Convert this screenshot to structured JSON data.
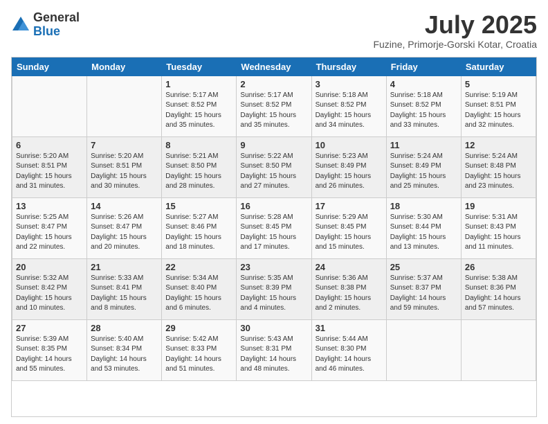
{
  "logo": {
    "general": "General",
    "blue": "Blue"
  },
  "title": "July 2025",
  "location": "Fuzine, Primorje-Gorski Kotar, Croatia",
  "weekdays": [
    "Sunday",
    "Monday",
    "Tuesday",
    "Wednesday",
    "Thursday",
    "Friday",
    "Saturday"
  ],
  "weeks": [
    [
      {
        "day": "",
        "detail": ""
      },
      {
        "day": "",
        "detail": ""
      },
      {
        "day": "1",
        "detail": "Sunrise: 5:17 AM\nSunset: 8:52 PM\nDaylight: 15 hours and 35 minutes."
      },
      {
        "day": "2",
        "detail": "Sunrise: 5:17 AM\nSunset: 8:52 PM\nDaylight: 15 hours and 35 minutes."
      },
      {
        "day": "3",
        "detail": "Sunrise: 5:18 AM\nSunset: 8:52 PM\nDaylight: 15 hours and 34 minutes."
      },
      {
        "day": "4",
        "detail": "Sunrise: 5:18 AM\nSunset: 8:52 PM\nDaylight: 15 hours and 33 minutes."
      },
      {
        "day": "5",
        "detail": "Sunrise: 5:19 AM\nSunset: 8:51 PM\nDaylight: 15 hours and 32 minutes."
      }
    ],
    [
      {
        "day": "6",
        "detail": "Sunrise: 5:20 AM\nSunset: 8:51 PM\nDaylight: 15 hours and 31 minutes."
      },
      {
        "day": "7",
        "detail": "Sunrise: 5:20 AM\nSunset: 8:51 PM\nDaylight: 15 hours and 30 minutes."
      },
      {
        "day": "8",
        "detail": "Sunrise: 5:21 AM\nSunset: 8:50 PM\nDaylight: 15 hours and 28 minutes."
      },
      {
        "day": "9",
        "detail": "Sunrise: 5:22 AM\nSunset: 8:50 PM\nDaylight: 15 hours and 27 minutes."
      },
      {
        "day": "10",
        "detail": "Sunrise: 5:23 AM\nSunset: 8:49 PM\nDaylight: 15 hours and 26 minutes."
      },
      {
        "day": "11",
        "detail": "Sunrise: 5:24 AM\nSunset: 8:49 PM\nDaylight: 15 hours and 25 minutes."
      },
      {
        "day": "12",
        "detail": "Sunrise: 5:24 AM\nSunset: 8:48 PM\nDaylight: 15 hours and 23 minutes."
      }
    ],
    [
      {
        "day": "13",
        "detail": "Sunrise: 5:25 AM\nSunset: 8:47 PM\nDaylight: 15 hours and 22 minutes."
      },
      {
        "day": "14",
        "detail": "Sunrise: 5:26 AM\nSunset: 8:47 PM\nDaylight: 15 hours and 20 minutes."
      },
      {
        "day": "15",
        "detail": "Sunrise: 5:27 AM\nSunset: 8:46 PM\nDaylight: 15 hours and 18 minutes."
      },
      {
        "day": "16",
        "detail": "Sunrise: 5:28 AM\nSunset: 8:45 PM\nDaylight: 15 hours and 17 minutes."
      },
      {
        "day": "17",
        "detail": "Sunrise: 5:29 AM\nSunset: 8:45 PM\nDaylight: 15 hours and 15 minutes."
      },
      {
        "day": "18",
        "detail": "Sunrise: 5:30 AM\nSunset: 8:44 PM\nDaylight: 15 hours and 13 minutes."
      },
      {
        "day": "19",
        "detail": "Sunrise: 5:31 AM\nSunset: 8:43 PM\nDaylight: 15 hours and 11 minutes."
      }
    ],
    [
      {
        "day": "20",
        "detail": "Sunrise: 5:32 AM\nSunset: 8:42 PM\nDaylight: 15 hours and 10 minutes."
      },
      {
        "day": "21",
        "detail": "Sunrise: 5:33 AM\nSunset: 8:41 PM\nDaylight: 15 hours and 8 minutes."
      },
      {
        "day": "22",
        "detail": "Sunrise: 5:34 AM\nSunset: 8:40 PM\nDaylight: 15 hours and 6 minutes."
      },
      {
        "day": "23",
        "detail": "Sunrise: 5:35 AM\nSunset: 8:39 PM\nDaylight: 15 hours and 4 minutes."
      },
      {
        "day": "24",
        "detail": "Sunrise: 5:36 AM\nSunset: 8:38 PM\nDaylight: 15 hours and 2 minutes."
      },
      {
        "day": "25",
        "detail": "Sunrise: 5:37 AM\nSunset: 8:37 PM\nDaylight: 14 hours and 59 minutes."
      },
      {
        "day": "26",
        "detail": "Sunrise: 5:38 AM\nSunset: 8:36 PM\nDaylight: 14 hours and 57 minutes."
      }
    ],
    [
      {
        "day": "27",
        "detail": "Sunrise: 5:39 AM\nSunset: 8:35 PM\nDaylight: 14 hours and 55 minutes."
      },
      {
        "day": "28",
        "detail": "Sunrise: 5:40 AM\nSunset: 8:34 PM\nDaylight: 14 hours and 53 minutes."
      },
      {
        "day": "29",
        "detail": "Sunrise: 5:42 AM\nSunset: 8:33 PM\nDaylight: 14 hours and 51 minutes."
      },
      {
        "day": "30",
        "detail": "Sunrise: 5:43 AM\nSunset: 8:31 PM\nDaylight: 14 hours and 48 minutes."
      },
      {
        "day": "31",
        "detail": "Sunrise: 5:44 AM\nSunset: 8:30 PM\nDaylight: 14 hours and 46 minutes."
      },
      {
        "day": "",
        "detail": ""
      },
      {
        "day": "",
        "detail": ""
      }
    ]
  ]
}
